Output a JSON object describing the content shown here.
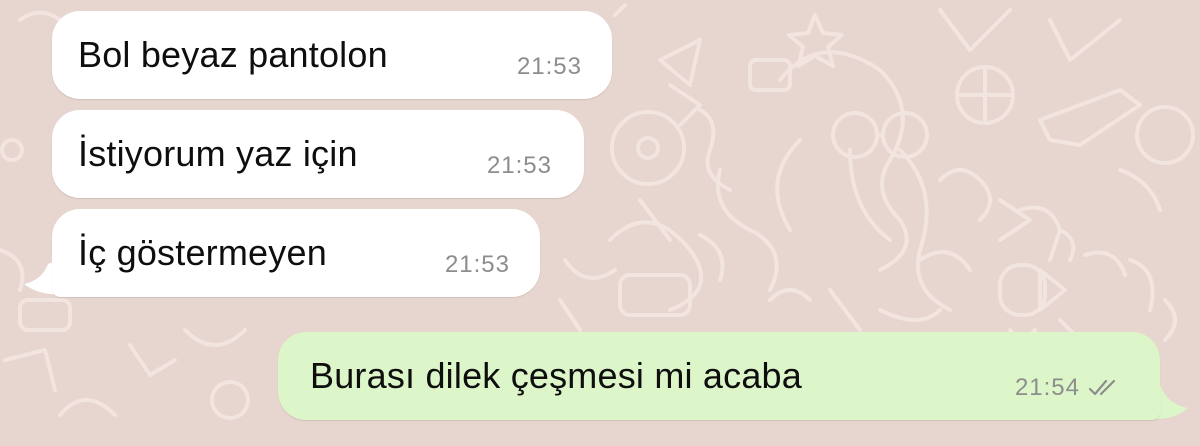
{
  "theme": {
    "wallpaper_color": "#e7d5cf",
    "incoming_bubble_color": "#ffffff",
    "outgoing_bubble_color": "#ddf6c9",
    "text_color": "#0e0e0e",
    "time_color": "#8d8d8d"
  },
  "messages": [
    {
      "direction": "incoming",
      "text": "Bol beyaz pantolon",
      "time": "21:53"
    },
    {
      "direction": "incoming",
      "text": "İstiyorum yaz için",
      "time": "21:53"
    },
    {
      "direction": "incoming",
      "text": "İç göstermeyen",
      "time": "21:53"
    },
    {
      "direction": "outgoing",
      "text": "Burası dilek çeşmesi mi acaba",
      "time": "21:54",
      "status_icon": "double-check-read-icon"
    }
  ]
}
